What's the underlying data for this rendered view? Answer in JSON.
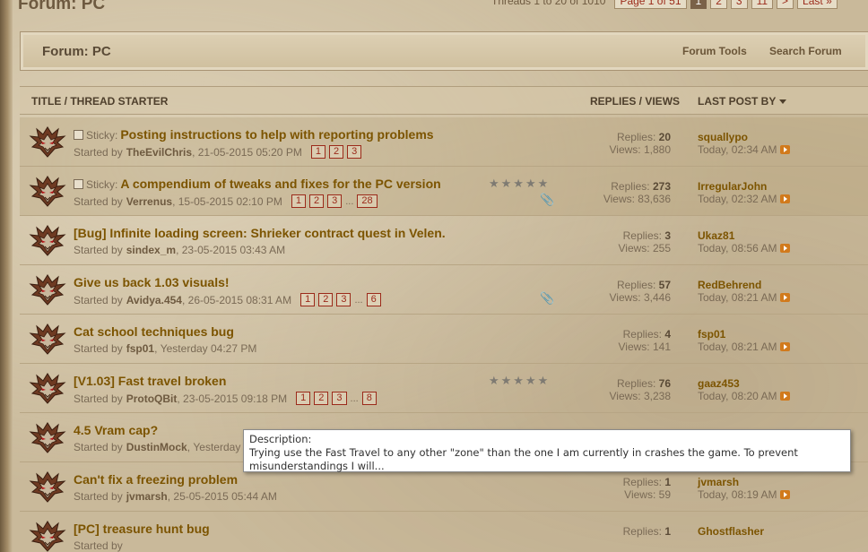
{
  "page": {
    "title": "Forum: PC",
    "pager": {
      "threads_text": "Threads 1 to 20 of 1010",
      "page_of": "Page 1 of 51",
      "pages": [
        "1",
        "2",
        "3",
        "11"
      ],
      "next": ">",
      "last": "Last »"
    }
  },
  "forum_bar": {
    "title": "Forum: PC",
    "tools": "Forum Tools",
    "search": "Search Forum"
  },
  "columns": {
    "title": "TITLE / THREAD STARTER",
    "replies_views": "REPLIES / VIEWS",
    "last_post": "LAST POST BY"
  },
  "threads": [
    {
      "sticky_label": "Sticky:",
      "title": "Posting instructions to help with reporting problems",
      "started_by": "Started by",
      "starter": "TheEvilChris",
      "date": "21-05-2015 05:20 PM",
      "pages": [
        "1",
        "2",
        "3"
      ],
      "replies_label": "Replies:",
      "replies": "20",
      "views_label": "Views:",
      "views": "1,880",
      "last_user": "squallypo",
      "last_time": "Today, 02:34 AM"
    },
    {
      "sticky_label": "Sticky:",
      "title": "A compendium of tweaks and fixes for the PC version",
      "started_by": "Started by",
      "starter": "Verrenus",
      "date": "15-05-2015 02:10 PM",
      "pages": [
        "1",
        "2",
        "3"
      ],
      "dots": "...",
      "last_page": "28",
      "stars": "★★★★★",
      "replies_label": "Replies:",
      "replies": "273",
      "views_label": "Views:",
      "views": "83,636",
      "last_user": "IrregularJohn",
      "last_time": "Today, 02:32 AM"
    },
    {
      "title": "[Bug] Infinite loading screen: Shrieker contract quest in Velen.",
      "started_by": "Started by",
      "starter": "sindex_m",
      "date": "23-05-2015 03:43 AM",
      "replies_label": "Replies:",
      "replies": "3",
      "views_label": "Views:",
      "views": "255",
      "last_user": "Ukaz81",
      "last_time": "Today, 08:56 AM"
    },
    {
      "title": "Give us back 1.03 visuals!",
      "started_by": "Started by",
      "starter": "Avidya.454",
      "date": "26-05-2015 08:31 AM",
      "pages": [
        "1",
        "2",
        "3"
      ],
      "dots": "...",
      "last_page": "6",
      "replies_label": "Replies:",
      "replies": "57",
      "views_label": "Views:",
      "views": "3,446",
      "last_user": "RedBehrend",
      "last_time": "Today, 08:21 AM"
    },
    {
      "title": "Cat school techniques bug",
      "started_by": "Started by",
      "starter": "fsp01",
      "date": "Yesterday 04:27 PM",
      "replies_label": "Replies:",
      "replies": "4",
      "views_label": "Views:",
      "views": "141",
      "last_user": "fsp01",
      "last_time": "Today, 08:21 AM"
    },
    {
      "title": "[V1.03] Fast travel broken",
      "started_by": "Started by",
      "starter": "ProtoQBit",
      "date": "23-05-2015 09:18 PM",
      "pages": [
        "1",
        "2",
        "3"
      ],
      "dots": "...",
      "last_page": "8",
      "stars": "★★★★★",
      "replies_label": "Replies:",
      "replies": "76",
      "views_label": "Views:",
      "views": "3,238",
      "last_user": "gaaz453",
      "last_time": "Today, 08:20 AM"
    },
    {
      "title": "4.5 Vram cap?",
      "started_by": "Started by",
      "starter": "DustinMock",
      "date": "Yesterday",
      "replies_label": "",
      "replies": "",
      "views_label": "",
      "views": "",
      "last_user": "",
      "last_time": ""
    },
    {
      "title": "Can't fix a freezing problem",
      "started_by": "Started by",
      "starter": "jvmarsh",
      "date": "25-05-2015 05:44 AM",
      "replies_label": "Replies:",
      "replies": "1",
      "views_label": "Views:",
      "views": "59",
      "last_user": "jvmarsh",
      "last_time": "Today, 08:19 AM"
    },
    {
      "title": "[PC] treasure hunt bug",
      "started_by": "Started by",
      "starter": "",
      "date": "",
      "replies_label": "Replies:",
      "replies": "1",
      "views_label": "",
      "views": "",
      "last_user": "Ghostflasher",
      "last_time": ""
    }
  ],
  "tooltip": {
    "heading": "Description:",
    "text": "Trying use the Fast Travel to any other \"zone\" than the one I am currently in crashes the game. To prevent misunderstandings I will..."
  },
  "icons": {
    "thread_icon": "wolf-medallion-icon",
    "goto_icon": "go-to-last-post-icon",
    "attachment_icon": "paperclip-icon"
  }
}
